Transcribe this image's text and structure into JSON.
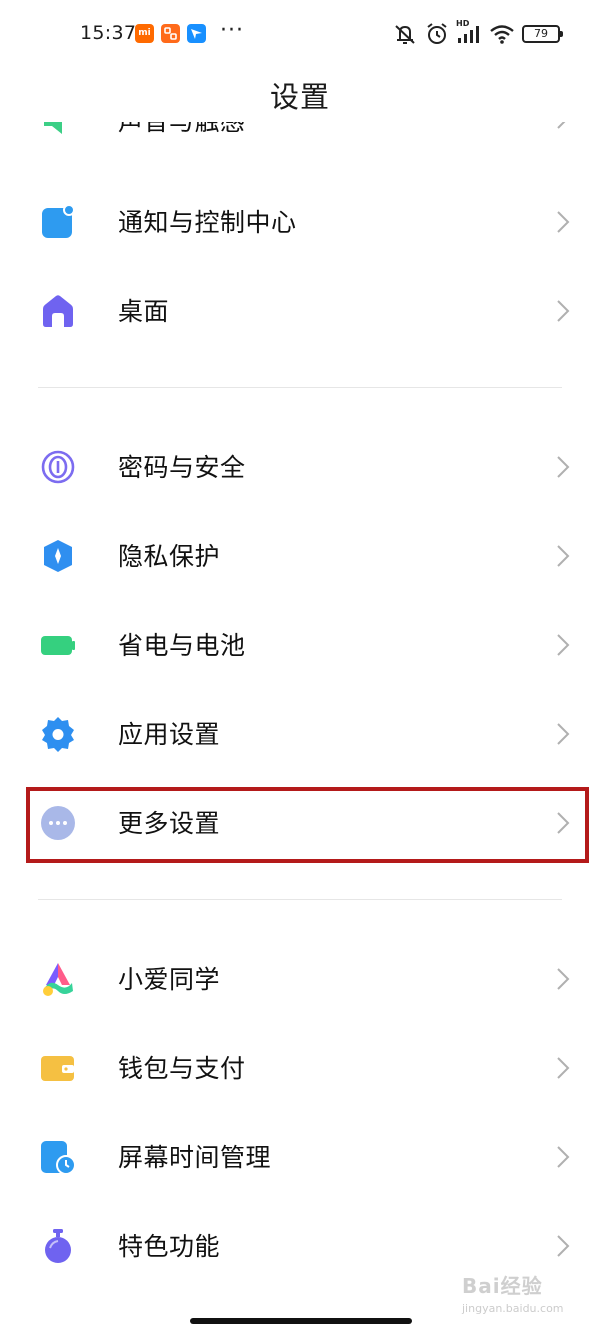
{
  "status_bar": {
    "time": "15:37",
    "app_mi_label": "mi",
    "more_dots": "···",
    "battery_level": "79",
    "network_label": "HD"
  },
  "header": {
    "title": "设置"
  },
  "settings": {
    "partial_item": {
      "label": "声音与触感",
      "icon": "speaker-icon"
    },
    "group1": [
      {
        "label": "通知与控制中心",
        "icon": "notification-icon",
        "color": "#2e9bf0"
      },
      {
        "label": "桌面",
        "icon": "home-icon",
        "color": "#6f63f0"
      }
    ],
    "group2": [
      {
        "label": "密码与安全",
        "icon": "fingerprint-icon",
        "color": "#7c6cf0"
      },
      {
        "label": "隐私保护",
        "icon": "privacy-shield-icon",
        "color": "#2f8ff0"
      },
      {
        "label": "省电与电池",
        "icon": "battery-icon",
        "color": "#35d07f"
      },
      {
        "label": "应用设置",
        "icon": "gear-icon",
        "color": "#2e8ff0"
      },
      {
        "label": "更多设置",
        "icon": "more-dots-icon",
        "color": "#a9b8e8"
      }
    ],
    "group3": [
      {
        "label": "小爱同学",
        "icon": "xiaoai-icon"
      },
      {
        "label": "钱包与支付",
        "icon": "wallet-icon",
        "color": "#f5c042"
      },
      {
        "label": "屏幕时间管理",
        "icon": "screen-time-icon",
        "color": "#2e9bf0"
      },
      {
        "label": "特色功能",
        "icon": "features-icon",
        "color": "#6f63f0"
      }
    ]
  },
  "highlight_color": "#b41a1a",
  "watermark": {
    "logo": "Bai经验",
    "url": "jingyan.baidu.com"
  }
}
